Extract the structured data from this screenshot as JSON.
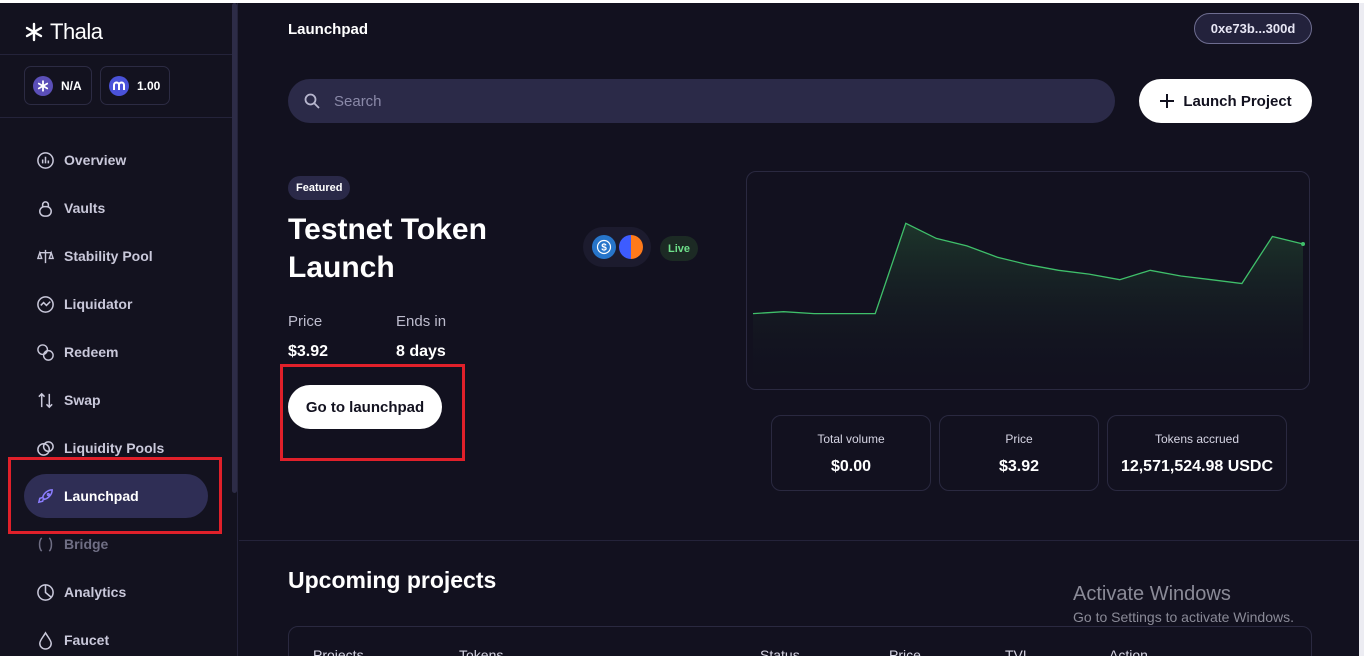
{
  "brand": {
    "name": "Thala"
  },
  "balances": [
    {
      "icon": "thala-token-icon",
      "value": "N/A"
    },
    {
      "icon": "mod-token-icon",
      "value": "1.00"
    }
  ],
  "nav": [
    {
      "label": "Overview",
      "icon": "overview-icon"
    },
    {
      "label": "Vaults",
      "icon": "vault-icon"
    },
    {
      "label": "Stability Pool",
      "icon": "scale-icon"
    },
    {
      "label": "Liquidator",
      "icon": "liquidator-icon"
    },
    {
      "label": "Redeem",
      "icon": "redeem-icon"
    },
    {
      "label": "Swap",
      "icon": "swap-icon"
    },
    {
      "label": "Liquidity Pools",
      "icon": "pools-icon"
    },
    {
      "label": "Launchpad",
      "icon": "rocket-icon",
      "active": true
    },
    {
      "label": "Bridge",
      "icon": "bridge-icon"
    },
    {
      "label": "Analytics",
      "icon": "analytics-icon"
    },
    {
      "label": "Faucet",
      "icon": "faucet-icon"
    }
  ],
  "header": {
    "title": "Launchpad",
    "wallet": "0xe73b...300d"
  },
  "search": {
    "placeholder": "Search"
  },
  "launch_button": {
    "label": "Launch Project"
  },
  "featured": {
    "badge": "Featured",
    "title": "Testnet Token Launch",
    "status": "Live",
    "price_label": "Price",
    "price_value": "$3.92",
    "ends_label": "Ends in",
    "ends_value": "8 days",
    "cta": "Go to launchpad"
  },
  "chart_data": {
    "type": "area",
    "x": [
      0,
      1,
      2,
      3,
      4,
      5,
      6,
      7,
      8,
      9,
      10,
      11,
      12,
      13,
      14,
      15,
      16,
      17,
      18
    ],
    "values": [
      0.3,
      0.31,
      0.3,
      0.3,
      0.3,
      0.78,
      0.7,
      0.66,
      0.6,
      0.56,
      0.53,
      0.51,
      0.48,
      0.53,
      0.5,
      0.48,
      0.46,
      0.71,
      0.67
    ],
    "color": "#3fbf6a",
    "grid": false
  },
  "stats": [
    {
      "label": "Total volume",
      "value": "$0.00"
    },
    {
      "label": "Price",
      "value": "$3.92"
    },
    {
      "label": "Tokens accrued",
      "value": "12,571,524.98 USDC"
    }
  ],
  "upcoming": {
    "title": "Upcoming projects",
    "columns": [
      "Projects",
      "Tokens",
      "Status",
      "Price",
      "TVL",
      "Action"
    ]
  },
  "watermark": {
    "line1": "Activate Windows",
    "line2": "Go to Settings to activate Windows."
  }
}
